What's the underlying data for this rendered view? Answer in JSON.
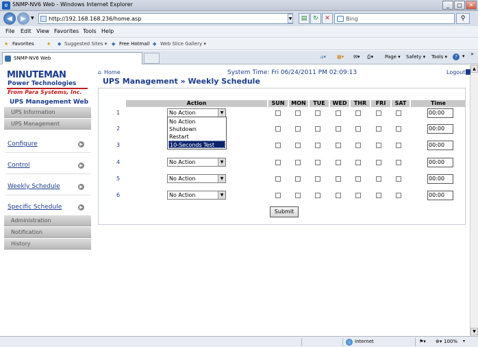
{
  "window": {
    "title": "SNMP-NV6 Web - Windows Internet Explorer"
  },
  "address": {
    "url": "http://192.168.168.236/home.asp"
  },
  "search": {
    "placeholder": "Bing"
  },
  "menu": [
    "File",
    "Edit",
    "View",
    "Favorites",
    "Tools",
    "Help"
  ],
  "favorites": {
    "label": "Favorites",
    "items": [
      "Suggested Sites ▾",
      "Free Hotmail",
      "Web Slice Gallery ▾"
    ]
  },
  "tab": {
    "label": "SNMP-NV6 Web"
  },
  "toolbar": {
    "page": "Page ▾",
    "safety": "Safety ▾",
    "tools": "Tools ▾",
    "help": "?"
  },
  "status": {
    "zone": "Internet",
    "zoom": "100%"
  },
  "logo": {
    "main": "MINUTEMAN",
    "sub": "Power Technologies",
    "para": "From Para Systems, Inc."
  },
  "sidebar": {
    "title": "UPS Management Web",
    "grey_top": [
      "UPS Information",
      "UPS Management"
    ],
    "links": [
      "Configure",
      "Control",
      "Weekly Schedule",
      "Specific Schedule"
    ],
    "grey_bottom": [
      "Administration",
      "Notification",
      "History"
    ]
  },
  "header": {
    "home": "Home",
    "system_time": "System Time: Fri 06/24/2011 PM 02:09:13",
    "logout": "Logout"
  },
  "page_title": "UPS Management » Weekly Schedule",
  "table": {
    "columns": [
      "Action",
      "SUN",
      "MON",
      "TUE",
      "WED",
      "THR",
      "FRI",
      "SAT",
      "Time"
    ],
    "rows": [
      {
        "num": "1",
        "action": "No Action",
        "time": "00:00"
      },
      {
        "num": "2",
        "action": "",
        "time": "00:00"
      },
      {
        "num": "3",
        "action": "",
        "time": "00:00"
      },
      {
        "num": "4",
        "action": "No Action",
        "time": "00:00"
      },
      {
        "num": "5",
        "action": "No Action",
        "time": "00:00"
      },
      {
        "num": "6",
        "action": "No Action",
        "time": "00:00"
      }
    ]
  },
  "dropdown_options": [
    "No Action",
    "Shutdown",
    "Restart",
    "10-Seconds Test"
  ],
  "submit_label": "Submit"
}
